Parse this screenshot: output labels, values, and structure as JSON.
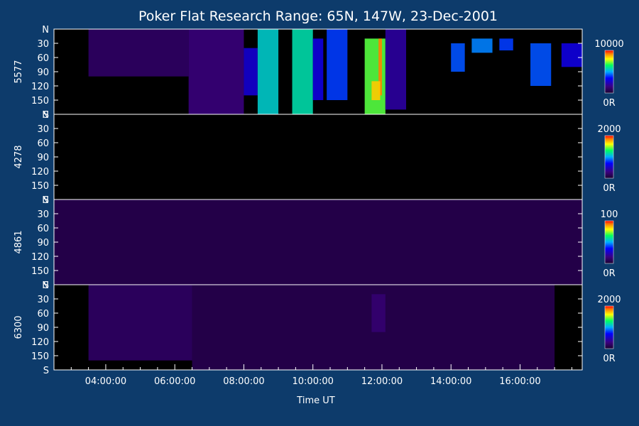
{
  "chart_data": {
    "type": "heatmap",
    "title": "Poker Flat Research Range: 65N, 147W, 23-Dec-2001",
    "xlabel": "Time UT",
    "x_range_hours": [
      2.5,
      17.8
    ],
    "x_ticks": [
      {
        "hour": 4,
        "label": "04:00:00"
      },
      {
        "hour": 6,
        "label": "06:00:00"
      },
      {
        "hour": 8,
        "label": "08:00:00"
      },
      {
        "hour": 10,
        "label": "10:00:00"
      },
      {
        "hour": 12,
        "label": "12:00:00"
      },
      {
        "hour": 14,
        "label": "14:00:00"
      },
      {
        "hour": 16,
        "label": "16:00:00"
      }
    ],
    "y_tick_labels": [
      "N",
      "30",
      "60",
      "90",
      "120",
      "150",
      "S"
    ],
    "y_range_deg": [
      0,
      180
    ],
    "panels": [
      {
        "name": "5577",
        "colorbar": {
          "max_label": "10000",
          "min_label": "0R",
          "max": 10000,
          "min": 0
        },
        "features": [
          {
            "t0": 3.5,
            "t1": 6.4,
            "d0": 0,
            "d1": 100,
            "intensity": 0.1
          },
          {
            "t0": 6.4,
            "t1": 8.0,
            "d0": 0,
            "d1": 180,
            "intensity": 0.14
          },
          {
            "t0": 8.0,
            "t1": 8.4,
            "d0": 40,
            "d1": 140,
            "intensity": 0.28
          },
          {
            "t0": 8.4,
            "t1": 9.0,
            "d0": 0,
            "d1": 180,
            "intensity": 0.55
          },
          {
            "t0": 9.4,
            "t1": 10.0,
            "d0": 0,
            "d1": 180,
            "intensity": 0.58
          },
          {
            "t0": 10.0,
            "t1": 10.3,
            "d0": 20,
            "d1": 150,
            "intensity": 0.3
          },
          {
            "t0": 10.4,
            "t1": 11.0,
            "d0": 0,
            "d1": 150,
            "intensity": 0.4
          },
          {
            "t0": 11.5,
            "t1": 12.1,
            "d0": 20,
            "d1": 180,
            "intensity": 0.7
          },
          {
            "t0": 11.9,
            "t1": 12.0,
            "d0": 20,
            "d1": 140,
            "intensity": 0.92
          },
          {
            "t0": 11.7,
            "t1": 11.95,
            "d0": 110,
            "d1": 150,
            "intensity": 0.85
          },
          {
            "t0": 12.1,
            "t1": 12.7,
            "d0": 0,
            "d1": 170,
            "intensity": 0.2
          },
          {
            "t0": 14.0,
            "t1": 14.4,
            "d0": 30,
            "d1": 90,
            "intensity": 0.42
          },
          {
            "t0": 14.6,
            "t1": 15.2,
            "d0": 20,
            "d1": 50,
            "intensity": 0.46
          },
          {
            "t0": 15.4,
            "t1": 15.8,
            "d0": 20,
            "d1": 45,
            "intensity": 0.4
          },
          {
            "t0": 16.3,
            "t1": 16.9,
            "d0": 30,
            "d1": 120,
            "intensity": 0.42
          },
          {
            "t0": 17.2,
            "t1": 17.8,
            "d0": 30,
            "d1": 80,
            "intensity": 0.3
          }
        ]
      },
      {
        "name": "4278",
        "colorbar": {
          "max_label": "2000",
          "min_label": "0R",
          "max": 2000,
          "min": 0
        },
        "features": []
      },
      {
        "name": "4861",
        "colorbar": {
          "max_label": "100",
          "min_label": "0R",
          "max": 100,
          "min": 0
        },
        "features": [
          {
            "t0": 2.5,
            "t1": 17.8,
            "d0": 0,
            "d1": 180,
            "intensity": 0.06
          }
        ]
      },
      {
        "name": "6300",
        "colorbar": {
          "max_label": "2000",
          "min_label": "0R",
          "max": 2000,
          "min": 0
        },
        "features": [
          {
            "t0": 3.5,
            "t1": 6.5,
            "d0": 0,
            "d1": 160,
            "intensity": 0.1
          },
          {
            "t0": 6.5,
            "t1": 17.0,
            "d0": 0,
            "d1": 180,
            "intensity": 0.06
          },
          {
            "t0": 11.7,
            "t1": 12.1,
            "d0": 20,
            "d1": 100,
            "intensity": 0.12
          }
        ]
      }
    ]
  }
}
